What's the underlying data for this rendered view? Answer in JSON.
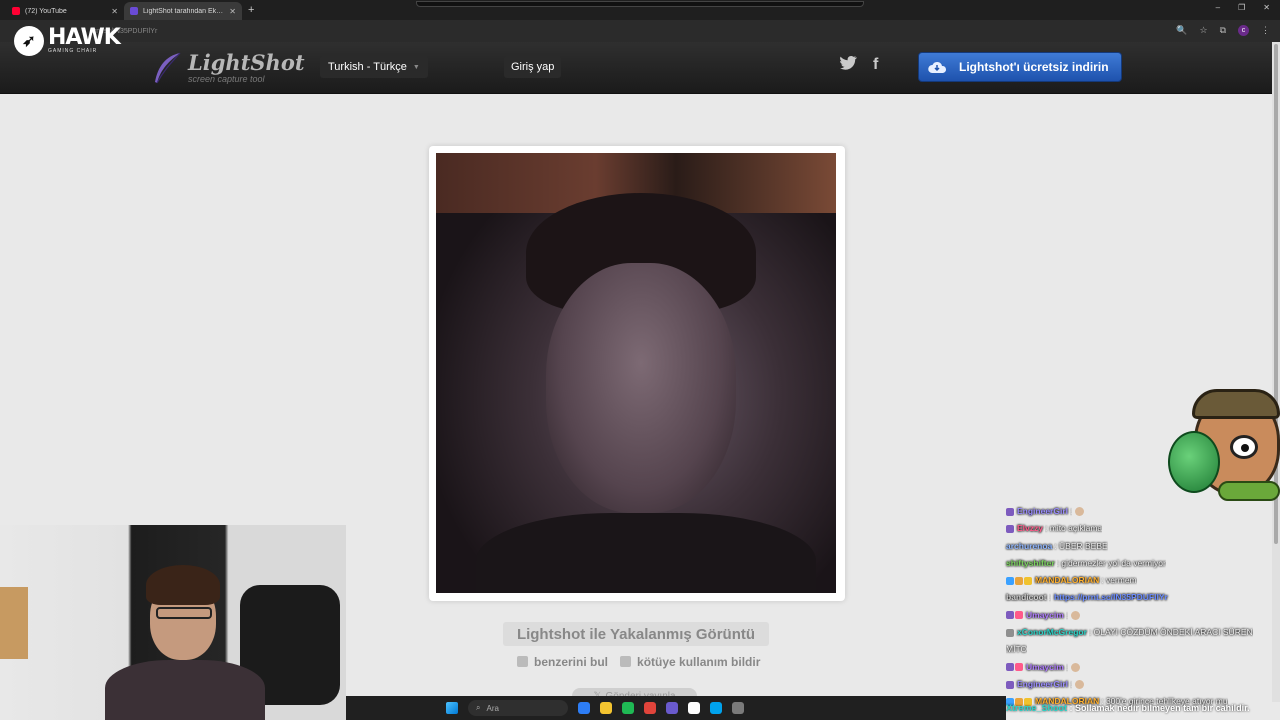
{
  "browser": {
    "tabs": [
      {
        "label": "(72) YouTube",
        "color": "#ff0033"
      },
      {
        "label": "LightShot tarafından Ekran Görüntüsü",
        "color": "#6a4bd6"
      }
    ],
    "new_tab": "+",
    "url": "prnt.sc/IN35PDUFIlYr",
    "profile_initial": "c",
    "window_controls": [
      "–",
      "❐",
      "✕"
    ]
  },
  "overlay_brand": {
    "name": "HAWK",
    "tagline": "GAMING CHAIR"
  },
  "lightshot": {
    "logo_name": "LightShot",
    "logo_sub": "screen capture tool",
    "language": "Turkish - Türkçe",
    "login": "Giriş yap",
    "social": [
      "twitter-icon",
      "facebook-icon"
    ],
    "download_label": "Lightshot'ı ücretsiz indirin",
    "caption": "Lightshot ile Yakalanmış Görüntü",
    "actions": [
      "benzerini bul",
      "kötüye kullanım bildir"
    ],
    "send_label": "Gönderi yayınla"
  },
  "chat": {
    "messages": [
      {
        "user": "EngineerGirl",
        "user_color": "#9a8cff",
        "text": ":",
        "emote": true,
        "badges": [
          "#7d5bbe"
        ]
      },
      {
        "user": "Elvzzy",
        "user_color": "#ff5a8a",
        "text": ": mito açıklama",
        "badges": [
          "#7d5bbe"
        ]
      },
      {
        "user": "archurenoa",
        "user_color": "#8fb6ff",
        "text": ": ÜBER BEBE",
        "badges": []
      },
      {
        "user": "shiftyshifter",
        "user_color": "#7ad15e",
        "text": ": gidermezler yol da vermiyor",
        "badges": []
      },
      {
        "user": "MANDALORIAN",
        "user_color": "#ffb02e",
        "text": ": vermem",
        "badges": [
          "#3ba1ff",
          "#e9a33a",
          "#f0c22e"
        ]
      },
      {
        "user": "bandicoot",
        "user_color": "#cccccc",
        "text": ":",
        "link": "https://prnt.sc/IN35PDUFIlYr",
        "badges": []
      },
      {
        "user": "Umaycim",
        "user_color": "#b07dff",
        "text": ":",
        "emote": true,
        "badges": [
          "#7d5bbe",
          "#ff5a8a"
        ]
      },
      {
        "user": "xConorMcGregor",
        "user_color": "#2bd3c7",
        "text": ": OLAYI ÇÖZDÜM ÖNDEKİ ARACI SÜREN",
        "badges": [
          "#8f8f8f"
        ]
      },
      {
        "user": "",
        "user_color": "#ffffff",
        "text": "MİTO",
        "badges": []
      },
      {
        "user": "Umaycim",
        "user_color": "#b07dff",
        "text": ":",
        "emote": true,
        "badges": [
          "#7d5bbe",
          "#ff5a8a"
        ]
      },
      {
        "user": "EngineerGirl",
        "user_color": "#9a8cff",
        "text": ":",
        "emote": true,
        "badges": [
          "#7d5bbe"
        ]
      },
      {
        "user": "MANDALORIAN",
        "user_color": "#ffb02e",
        "text": ": 300'e girince tehlikeye atıyor mu",
        "badges": [
          "#3ba1ff",
          "#e9a33a",
          "#f0c22e"
        ]
      }
    ],
    "bottom_user": "Xtreme_Shoot",
    "bottom_text": ": Sollamak nedir bilmeyen tam bir cahildir."
  },
  "taskbar": {
    "search_placeholder": "Ara",
    "apps": [
      "#2d7df5",
      "#f4c430",
      "#1fb954",
      "#e0443b",
      "#6a5acd",
      "#ffffff",
      "#00a2ed",
      "#7a7a7a"
    ]
  }
}
